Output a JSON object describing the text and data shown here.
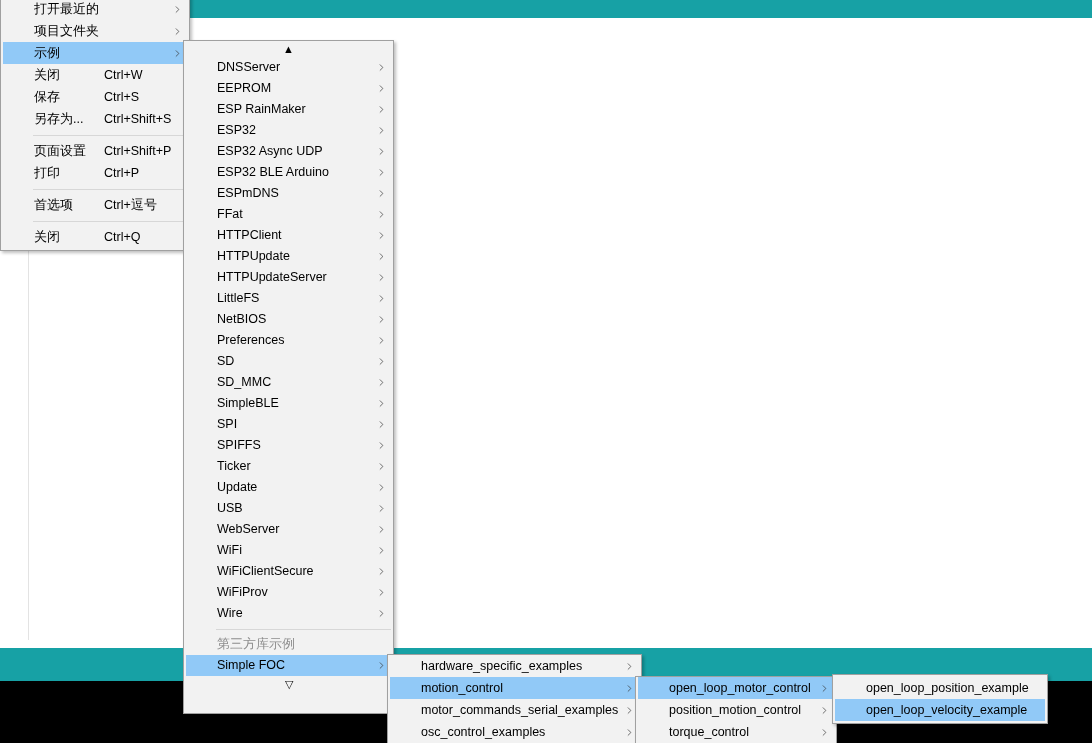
{
  "menus": [
    {
      "items": [
        {
          "kind": "item",
          "label": "打开最近的",
          "has_submenu": true,
          "selected": false
        },
        {
          "kind": "item",
          "label": "项目文件夹",
          "has_submenu": true,
          "selected": false
        },
        {
          "kind": "item",
          "label": "示例",
          "has_submenu": true,
          "selected": true
        },
        {
          "kind": "item",
          "label": "关闭",
          "shortcut": "Ctrl+W",
          "has_submenu": false,
          "selected": false
        },
        {
          "kind": "item",
          "label": "保存",
          "shortcut": "Ctrl+S",
          "has_submenu": false,
          "selected": false
        },
        {
          "kind": "item",
          "label": "另存为...",
          "shortcut": "Ctrl+Shift+S",
          "has_submenu": false,
          "selected": false
        },
        {
          "kind": "separator"
        },
        {
          "kind": "item",
          "label": "页面设置",
          "shortcut": "Ctrl+Shift+P",
          "has_submenu": false,
          "selected": false
        },
        {
          "kind": "item",
          "label": "打印",
          "shortcut": "Ctrl+P",
          "has_submenu": false,
          "selected": false
        },
        {
          "kind": "separator"
        },
        {
          "kind": "item",
          "label": "首选项",
          "shortcut": "Ctrl+逗号",
          "has_submenu": false,
          "selected": false
        },
        {
          "kind": "separator"
        },
        {
          "kind": "item",
          "label": "关闭",
          "shortcut": "Ctrl+Q",
          "has_submenu": false,
          "selected": false
        }
      ]
    },
    {
      "items": [
        {
          "kind": "scroll",
          "label": "▲"
        },
        {
          "kind": "item",
          "label": "DNSServer",
          "has_submenu": true,
          "selected": false
        },
        {
          "kind": "item",
          "label": "EEPROM",
          "has_submenu": true,
          "selected": false
        },
        {
          "kind": "item",
          "label": "ESP RainMaker",
          "has_submenu": true,
          "selected": false
        },
        {
          "kind": "item",
          "label": "ESP32",
          "has_submenu": true,
          "selected": false
        },
        {
          "kind": "item",
          "label": "ESP32 Async UDP",
          "has_submenu": true,
          "selected": false
        },
        {
          "kind": "item",
          "label": "ESP32 BLE Arduino",
          "has_submenu": true,
          "selected": false
        },
        {
          "kind": "item",
          "label": "ESPmDNS",
          "has_submenu": true,
          "selected": false
        },
        {
          "kind": "item",
          "label": "FFat",
          "has_submenu": true,
          "selected": false
        },
        {
          "kind": "item",
          "label": "HTTPClient",
          "has_submenu": true,
          "selected": false
        },
        {
          "kind": "item",
          "label": "HTTPUpdate",
          "has_submenu": true,
          "selected": false
        },
        {
          "kind": "item",
          "label": "HTTPUpdateServer",
          "has_submenu": true,
          "selected": false
        },
        {
          "kind": "item",
          "label": "LittleFS",
          "has_submenu": true,
          "selected": false
        },
        {
          "kind": "item",
          "label": "NetBIOS",
          "has_submenu": true,
          "selected": false
        },
        {
          "kind": "item",
          "label": "Preferences",
          "has_submenu": true,
          "selected": false
        },
        {
          "kind": "item",
          "label": "SD",
          "has_submenu": true,
          "selected": false
        },
        {
          "kind": "item",
          "label": "SD_MMC",
          "has_submenu": true,
          "selected": false
        },
        {
          "kind": "item",
          "label": "SimpleBLE",
          "has_submenu": true,
          "selected": false
        },
        {
          "kind": "item",
          "label": "SPI",
          "has_submenu": true,
          "selected": false
        },
        {
          "kind": "item",
          "label": "SPIFFS",
          "has_submenu": true,
          "selected": false
        },
        {
          "kind": "item",
          "label": "Ticker",
          "has_submenu": true,
          "selected": false
        },
        {
          "kind": "item",
          "label": "Update",
          "has_submenu": true,
          "selected": false
        },
        {
          "kind": "item",
          "label": "USB",
          "has_submenu": true,
          "selected": false
        },
        {
          "kind": "item",
          "label": "WebServer",
          "has_submenu": true,
          "selected": false
        },
        {
          "kind": "item",
          "label": "WiFi",
          "has_submenu": true,
          "selected": false
        },
        {
          "kind": "item",
          "label": "WiFiClientSecure",
          "has_submenu": true,
          "selected": false
        },
        {
          "kind": "item",
          "label": "WiFiProv",
          "has_submenu": true,
          "selected": false
        },
        {
          "kind": "item",
          "label": "Wire",
          "has_submenu": true,
          "selected": false
        },
        {
          "kind": "separator"
        },
        {
          "kind": "header",
          "label": "第三方库示例"
        },
        {
          "kind": "item",
          "label": "Simple FOC",
          "has_submenu": true,
          "selected": true
        },
        {
          "kind": "scroll",
          "label": "▽"
        }
      ]
    },
    {
      "items": [
        {
          "kind": "item",
          "label": "hardware_specific_examples",
          "has_submenu": true,
          "selected": false
        },
        {
          "kind": "item",
          "label": "motion_control",
          "has_submenu": true,
          "selected": true
        },
        {
          "kind": "item",
          "label": "motor_commands_serial_examples",
          "has_submenu": true,
          "selected": false
        },
        {
          "kind": "item",
          "label": "osc_control_examples",
          "has_submenu": true,
          "selected": false
        }
      ]
    },
    {
      "items": [
        {
          "kind": "item",
          "label": "open_loop_motor_control",
          "has_submenu": true,
          "selected": true
        },
        {
          "kind": "item",
          "label": "position_motion_control",
          "has_submenu": true,
          "selected": false
        },
        {
          "kind": "item",
          "label": "torque_control",
          "has_submenu": true,
          "selected": false
        }
      ]
    },
    {
      "items": [
        {
          "kind": "item",
          "label": "open_loop_position_example",
          "has_submenu": false,
          "selected": false
        },
        {
          "kind": "item",
          "label": "open_loop_velocity_example",
          "has_submenu": false,
          "selected": true
        }
      ]
    }
  ]
}
